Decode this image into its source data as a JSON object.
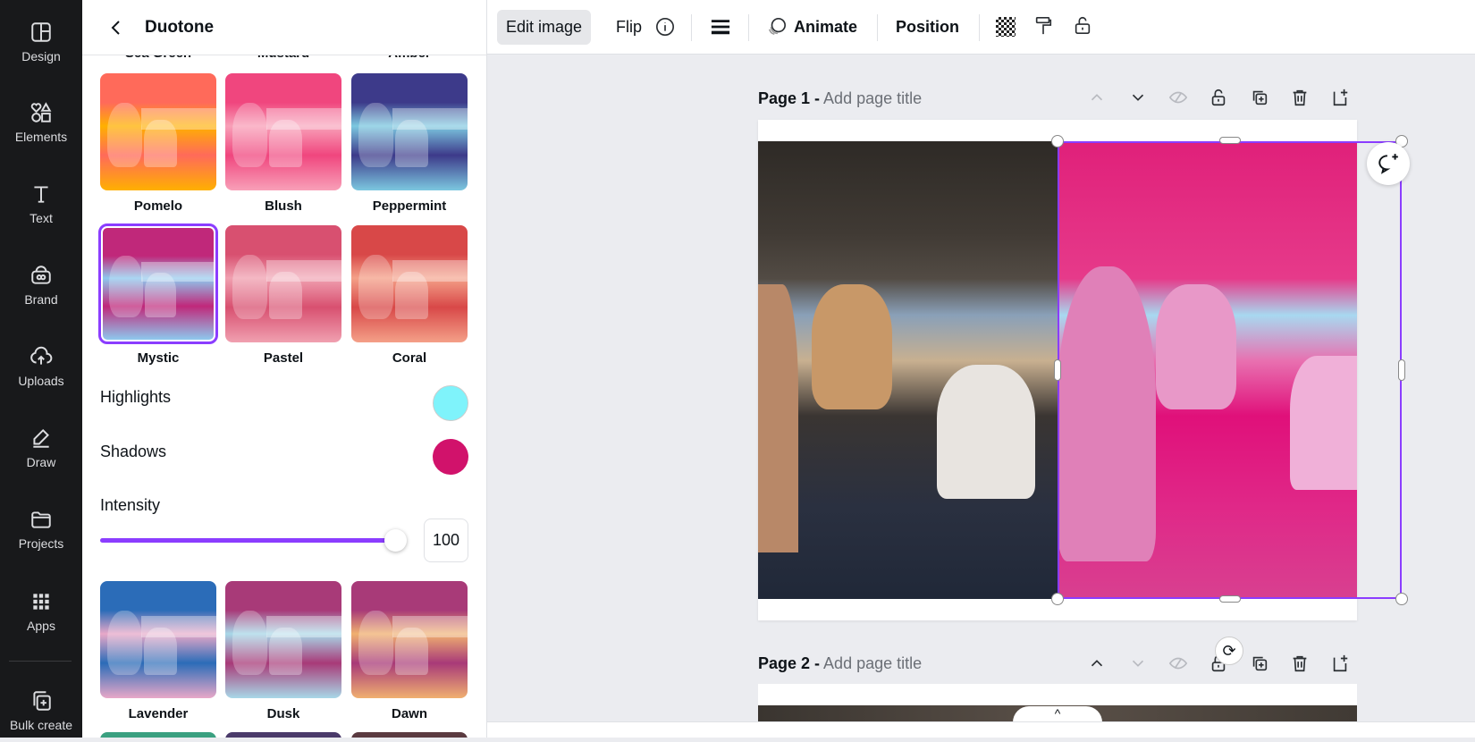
{
  "sidebar": {
    "items": [
      {
        "label": "Design",
        "icon": "layout-icon"
      },
      {
        "label": "Elements",
        "icon": "shapes-icon"
      },
      {
        "label": "Text",
        "icon": "text-icon"
      },
      {
        "label": "Brand",
        "icon": "brand-icon"
      },
      {
        "label": "Uploads",
        "icon": "upload-cloud-icon"
      },
      {
        "label": "Draw",
        "icon": "pen-icon"
      },
      {
        "label": "Projects",
        "icon": "folder-icon"
      },
      {
        "label": "Apps",
        "icon": "grid-icon"
      },
      {
        "label": "Bulk create",
        "icon": "bulk-create-icon"
      }
    ]
  },
  "panel": {
    "title": "Duotone",
    "partial_labels": [
      "Sea Green",
      "Mustard",
      "Amber"
    ],
    "presets": [
      {
        "label": "Pomelo",
        "c1": "#ff6a5a",
        "c2": "#ffb000"
      },
      {
        "label": "Blush",
        "c1": "#f0467e",
        "c2": "#f8a0b8"
      },
      {
        "label": "Peppermint",
        "c1": "#3d3a8a",
        "c2": "#7cc8e0"
      },
      {
        "label": "Mystic",
        "c1": "#c0287a",
        "c2": "#8ec8ee",
        "selected": true
      },
      {
        "label": "Pastel",
        "c1": "#d85070",
        "c2": "#f0a0b0"
      },
      {
        "label": "Coral",
        "c1": "#d84848",
        "c2": "#f4a088"
      },
      {
        "label": "Lavender",
        "c1": "#2b6cb8",
        "c2": "#e8a8c8"
      },
      {
        "label": "Dusk",
        "c1": "#a83a78",
        "c2": "#a8d8e8"
      },
      {
        "label": "Dawn",
        "c1": "#a83a78",
        "c2": "#f0b070"
      }
    ],
    "highlights_label": "Highlights",
    "highlights_color": "#7ff3fb",
    "shadows_label": "Shadows",
    "shadows_color": "#d1126b",
    "intensity_label": "Intensity",
    "intensity_value": "100",
    "intensity_fraction": 1.0,
    "accent": "#8b3dff"
  },
  "toolbar": {
    "edit_image": "Edit image",
    "flip": "Flip",
    "animate": "Animate",
    "position": "Position"
  },
  "pages": [
    {
      "label": "Page 1 -",
      "title_placeholder": "Add page title"
    },
    {
      "label": "Page 2 -",
      "title_placeholder": "Add page title"
    }
  ]
}
